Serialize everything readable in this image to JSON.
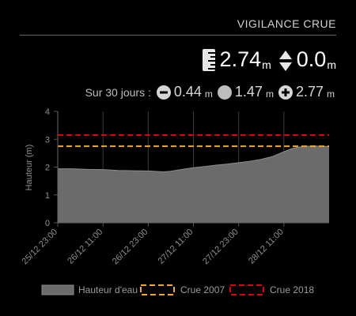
{
  "header": {
    "title": "VIGILANCE CRUE"
  },
  "current": {
    "level_value": "2.74",
    "level_unit": "m",
    "level_icon": "ruler-icon",
    "variation_value": "0.0",
    "variation_unit": "m",
    "variation_icon": "up-down-icon"
  },
  "stats": {
    "label": "Sur 30 jours :",
    "min_value": "0.44",
    "min_unit": "m",
    "min_icon": "minus-circle-icon",
    "avg_value": "1.47",
    "avg_unit": "m",
    "avg_icon": "circle-icon",
    "max_value": "2.77",
    "max_unit": "m",
    "max_icon": "plus-circle-icon"
  },
  "colors": {
    "area": "#6b6b6b",
    "area_line": "#8a8a8a",
    "crue2007": "#f5a623",
    "crue2018": "#e00000",
    "grid": "#3a3a3a",
    "axis_text": "#8f8f8f"
  },
  "chart_data": {
    "type": "area",
    "ylabel": "Hauteur (m)",
    "ylim": [
      0,
      4
    ],
    "yticks": [
      "0",
      "1",
      "2",
      "3",
      "4"
    ],
    "xlim": [
      0,
      72
    ],
    "xticks": [
      {
        "x": 0,
        "label": "25/12 23:00"
      },
      {
        "x": 12,
        "label": "26/12 11:00"
      },
      {
        "x": 24,
        "label": "26/12 23:00"
      },
      {
        "x": 36,
        "label": "27/12 11:00"
      },
      {
        "x": 48,
        "label": "27/12 23:00"
      },
      {
        "x": 60,
        "label": "28/12 11:00"
      }
    ],
    "series": [
      {
        "name": "Hauteur d'eau",
        "kind": "area",
        "x": [
          0,
          4,
          8,
          12,
          16,
          20,
          24,
          28,
          30,
          33,
          36,
          39,
          42,
          45,
          48,
          51,
          54,
          57,
          60,
          62,
          64,
          66,
          68,
          70,
          72
        ],
        "y": [
          1.94,
          1.94,
          1.92,
          1.91,
          1.88,
          1.87,
          1.86,
          1.83,
          1.85,
          1.92,
          1.98,
          2.02,
          2.07,
          2.11,
          2.16,
          2.21,
          2.28,
          2.38,
          2.55,
          2.66,
          2.72,
          2.75,
          2.76,
          2.75,
          2.74
        ]
      },
      {
        "name": "Crue 2007",
        "kind": "threshold",
        "y": 2.75
      },
      {
        "name": "Crue 2018",
        "kind": "threshold",
        "y": 3.15
      }
    ],
    "legend": [
      "Hauteur d'eau",
      "Crue 2007",
      "Crue 2018"
    ],
    "legend_position": "bottom",
    "grid": true
  }
}
